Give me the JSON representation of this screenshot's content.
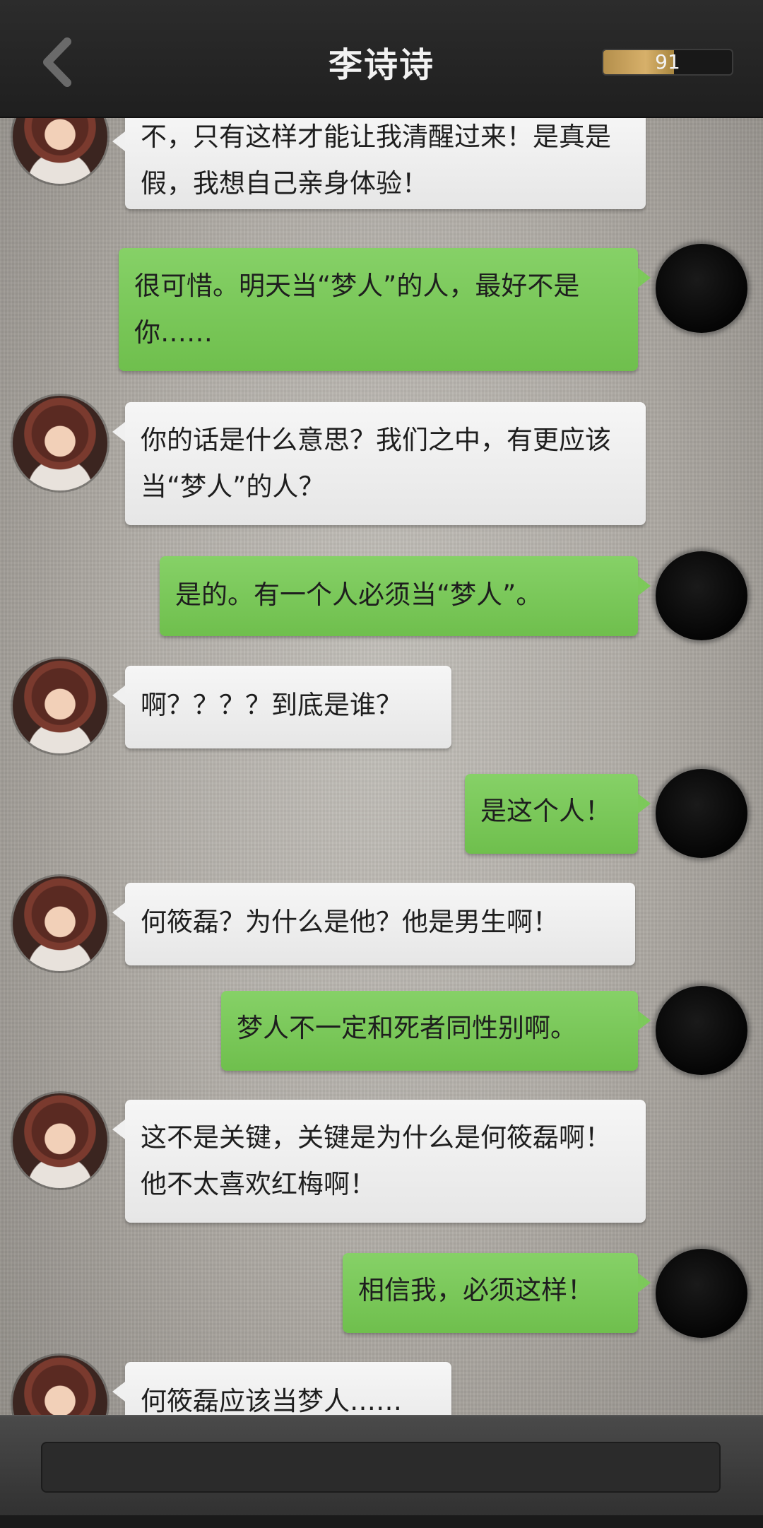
{
  "header": {
    "title": "李诗诗",
    "meter_value": "91",
    "meter_fill": 0.55
  },
  "messages": [
    {
      "side": "left",
      "text": "不，只有这样才能让我清醒过来！是真是假，我想自己亲身体验！"
    },
    {
      "side": "right",
      "text": "很可惜。明天当“梦人”的人，最好不是你……"
    },
    {
      "side": "left",
      "text": "你的话是什么意思？我们之中，有更应该当“梦人”的人？"
    },
    {
      "side": "right",
      "text": "是的。有一个人必须当“梦人”。"
    },
    {
      "side": "left",
      "text": "啊？？？？到底是谁？"
    },
    {
      "side": "right",
      "text": "是这个人！"
    },
    {
      "side": "left",
      "text": "何筱磊？为什么是他？他是男生啊！"
    },
    {
      "side": "right",
      "text": "梦人不一定和死者同性别啊。"
    },
    {
      "side": "left",
      "text": "这不是关键，关键是为什么是何筱磊啊！他不太喜欢红梅啊！"
    },
    {
      "side": "right",
      "text": "相信我，必须这样！"
    },
    {
      "side": "left",
      "text": "何筱磊应该当梦人……"
    }
  ],
  "input": {
    "value": ""
  },
  "colors": {
    "left_bubble": "#eeeeee",
    "right_bubble": "#7cc95a",
    "header": "#262626"
  }
}
